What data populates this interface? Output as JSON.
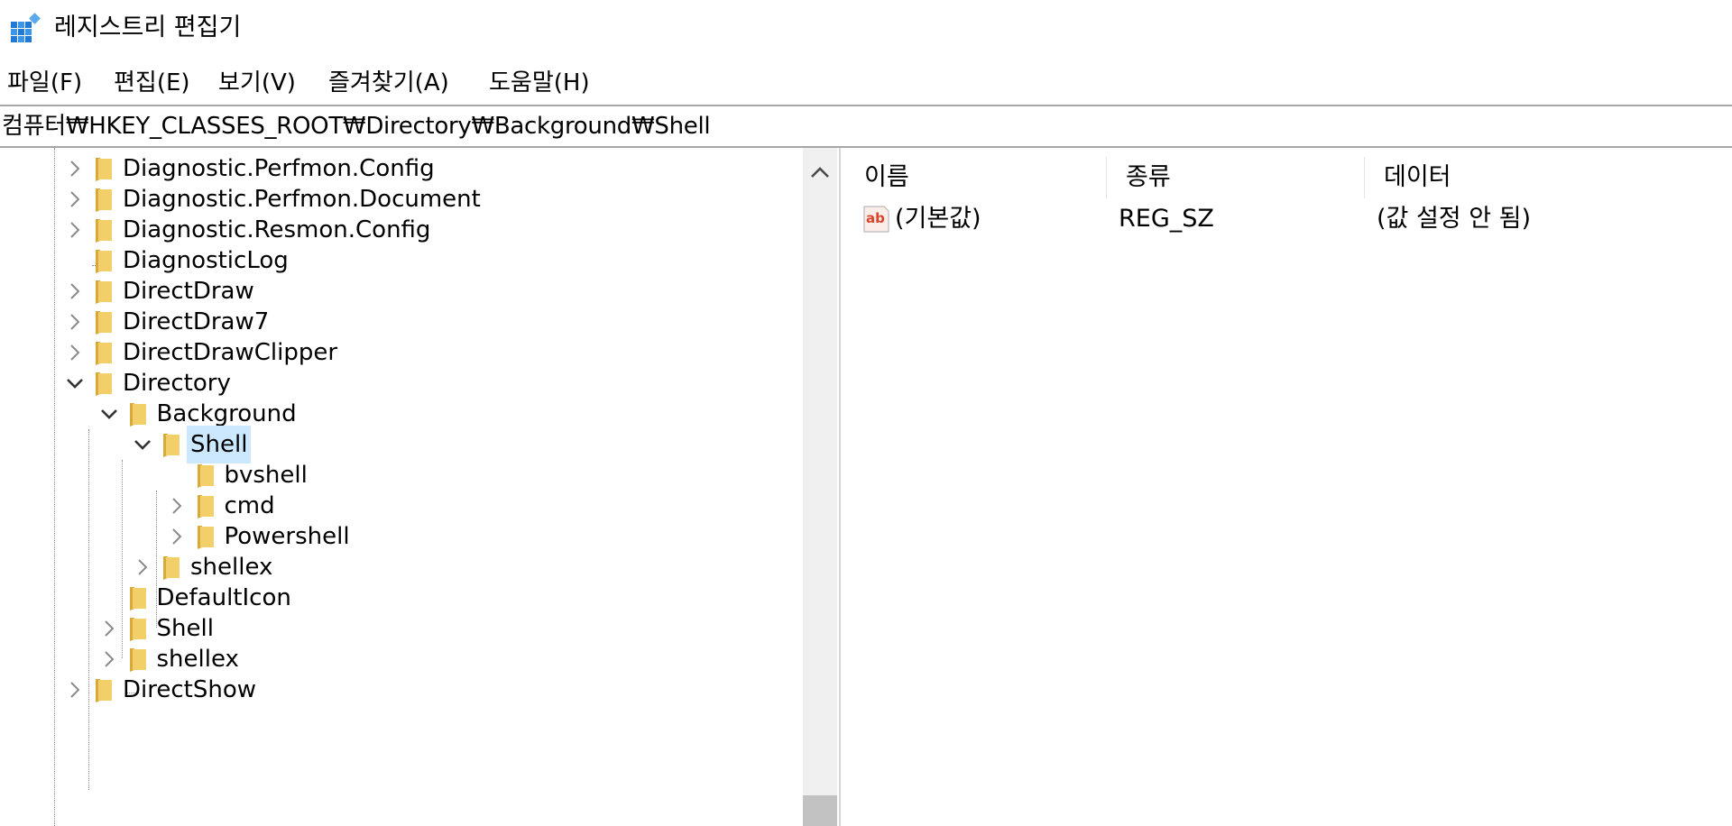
{
  "window": {
    "title": "레지스트리 편집기"
  },
  "menu": {
    "file": "파일(F)",
    "edit": "편집(E)",
    "view": "보기(V)",
    "favorites": "즐겨찾기(A)",
    "help": "도움말(H)"
  },
  "address": {
    "path": "컴퓨터₩HKEY_CLASSES_ROOT₩Directory₩Background₩Shell"
  },
  "tree": {
    "items": [
      {
        "label": "Diagnostic.Perfmon.Config",
        "expander": "collapsed",
        "level": 0
      },
      {
        "label": "Diagnostic.Perfmon.Document",
        "expander": "collapsed",
        "level": 0
      },
      {
        "label": "Diagnostic.Resmon.Config",
        "expander": "collapsed",
        "level": 0
      },
      {
        "label": "DiagnosticLog",
        "expander": "none",
        "level": 0
      },
      {
        "label": "DirectDraw",
        "expander": "collapsed",
        "level": 0
      },
      {
        "label": "DirectDraw7",
        "expander": "collapsed",
        "level": 0
      },
      {
        "label": "DirectDrawClipper",
        "expander": "collapsed",
        "level": 0
      },
      {
        "label": "Directory",
        "expander": "expanded",
        "level": 0
      },
      {
        "label": "Background",
        "expander": "expanded",
        "level": 1
      },
      {
        "label": "Shell",
        "expander": "expanded",
        "level": 2,
        "selected": true
      },
      {
        "label": "bvshell",
        "expander": "none",
        "level": 3
      },
      {
        "label": "cmd",
        "expander": "collapsed",
        "level": 3
      },
      {
        "label": "Powershell",
        "expander": "collapsed",
        "level": 3
      },
      {
        "label": "shellex",
        "expander": "collapsed",
        "level": 2
      },
      {
        "label": "DefaultIcon",
        "expander": "none",
        "level": 1
      },
      {
        "label": "Shell",
        "expander": "collapsed",
        "level": 1
      },
      {
        "label": "shellex",
        "expander": "collapsed",
        "level": 1
      },
      {
        "label": "DirectShow",
        "expander": "collapsed",
        "level": 0
      }
    ]
  },
  "list": {
    "columns": {
      "name": "이름",
      "type": "종류",
      "data": "데이터"
    },
    "rows": [
      {
        "name": "(기본값)",
        "type": "REG_SZ",
        "data": "(값 설정 안 됨)",
        "icon": "string-value-icon"
      }
    ]
  },
  "colors": {
    "selection": "#cce8ff",
    "folder": "#f3cf6a",
    "folder_dark": "#d9a93a",
    "value_icon": "#d9452c",
    "app_icon": "#1e7ad6"
  }
}
